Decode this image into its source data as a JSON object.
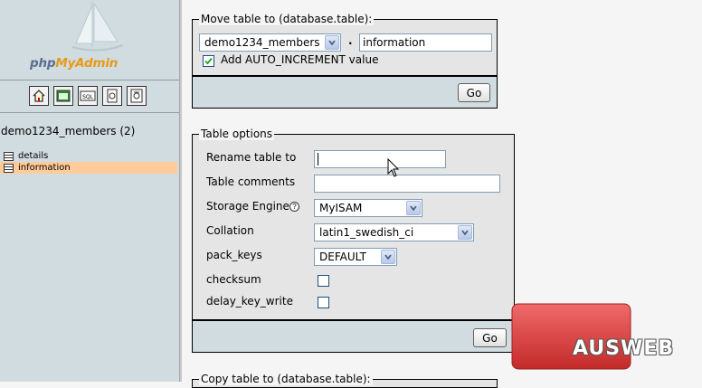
{
  "left": {
    "logo": {
      "part1": "php",
      "part2": "MyAdmin"
    },
    "nav_icons": [
      "home-icon",
      "query-window-icon",
      "sql-icon",
      "help-icon",
      "documentation-icon"
    ],
    "nav_icon_labels": {
      "sql": "SQL"
    },
    "db_title": "demo1234_members (2)",
    "tables": [
      {
        "name": "details",
        "active": false
      },
      {
        "name": "information",
        "active": true
      }
    ]
  },
  "move_table": {
    "legend": "Move table to (database.table):",
    "db_select": "demo1234_members",
    "separator": ".",
    "table_name": "information",
    "auto_increment_label": "Add AUTO_INCREMENT value",
    "auto_increment_checked": true,
    "go_label": "Go"
  },
  "table_options": {
    "legend": "Table options",
    "rename_label": "Rename table to",
    "rename_value": "",
    "comments_label": "Table comments",
    "comments_value": "",
    "engine_label": "Storage Engine",
    "engine_help": "?",
    "engine_value": "MyISAM",
    "collation_label": "Collation",
    "collation_value": "latin1_swedish_ci",
    "pack_keys_label": "pack_keys",
    "pack_keys_value": "DEFAULT",
    "checksum_label": "checksum",
    "checksum_checked": false,
    "delay_key_write_label": "delay_key_write",
    "delay_key_write_checked": false,
    "go_label": "Go"
  },
  "copy_table": {
    "legend": "Copy table to (database.table):"
  },
  "watermark": {
    "text": "AUSWEB"
  },
  "colors": {
    "left_bg": "#d0dce0",
    "active_row": "#ffcc99",
    "watermark_red": "#d93a3a"
  }
}
